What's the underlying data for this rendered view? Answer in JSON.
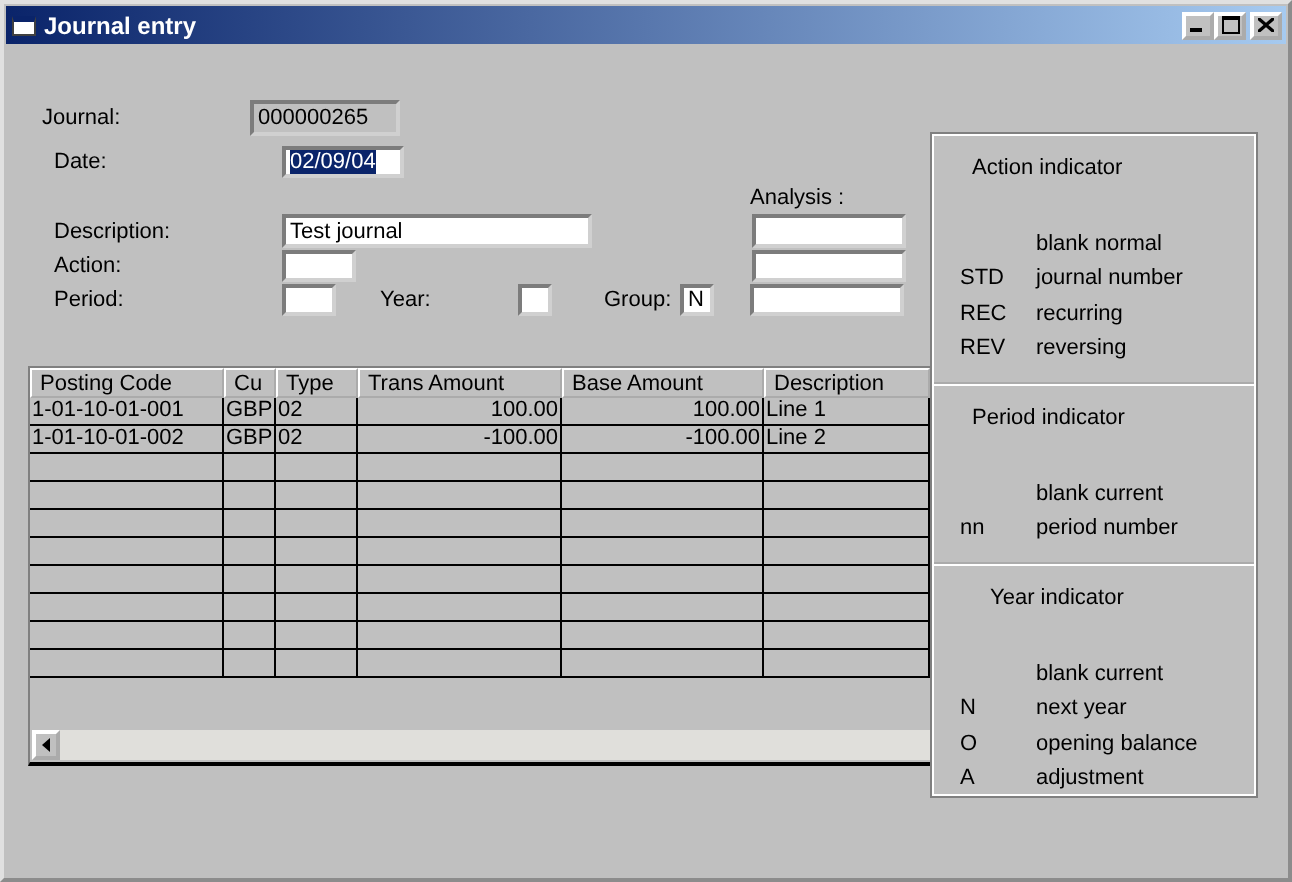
{
  "window": {
    "title": "Journal entry"
  },
  "form": {
    "journal": {
      "label": "Journal:",
      "value": "000000265",
      "read_only": true
    },
    "date": {
      "label": "Date:",
      "value": "02/09/04",
      "text_selected": true
    },
    "analysis": {
      "label": "Analysis :"
    },
    "description": {
      "label": "Description:",
      "value": "Test journal"
    },
    "action": {
      "label": "Action:"
    },
    "period": {
      "label": "Period:"
    },
    "year": {
      "label": "Year:"
    },
    "group": {
      "label": "Group:",
      "value": "N"
    }
  },
  "table": {
    "columns": [
      "Posting Code",
      "Cu",
      "Type",
      "Trans Amount",
      "Base Amount",
      "Description"
    ],
    "rows": [
      [
        "1-01-10-01-001",
        "GBP",
        "02",
        "100.00",
        "100.00",
        "Line 1"
      ],
      [
        "1-01-10-01-002",
        "GBP",
        "02",
        "-100.00",
        "-100.00",
        "Line 2"
      ]
    ]
  },
  "indicators": [
    {
      "title": "Action indicator",
      "items": [
        {
          "text": "blank normal"
        },
        {
          "code": "STD",
          "text": "journal number"
        },
        {
          "code": "REC",
          "text": "recurring"
        },
        {
          "code": "REV",
          "text": "reversing"
        }
      ]
    },
    {
      "title": "Period indicator",
      "items": [
        {
          "text": "blank current"
        },
        {
          "code": "nn",
          "text": "period number"
        }
      ]
    },
    {
      "title": "Year indicator",
      "items": [
        {
          "text": "blank current"
        },
        {
          "code": "N",
          "text": "next year"
        },
        {
          "code": "O",
          "text": "opening balance"
        },
        {
          "code": "A",
          "text": "adjustment"
        }
      ]
    }
  ]
}
